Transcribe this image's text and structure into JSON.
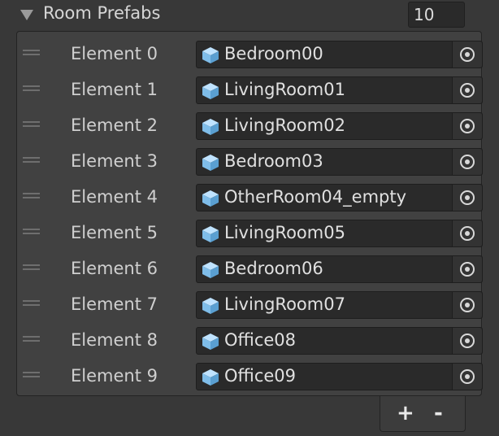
{
  "header": {
    "title": "Room Prefabs",
    "size_value": "10"
  },
  "list": {
    "items": [
      {
        "label": "Element 0",
        "value": "Bedroom00"
      },
      {
        "label": "Element 1",
        "value": "LivingRoom01"
      },
      {
        "label": "Element 2",
        "value": "LivingRoom02"
      },
      {
        "label": "Element 3",
        "value": "Bedroom03"
      },
      {
        "label": "Element 4",
        "value": "OtherRoom04_empty"
      },
      {
        "label": "Element 5",
        "value": "LivingRoom05"
      },
      {
        "label": "Element 6",
        "value": "Bedroom06"
      },
      {
        "label": "Element 7",
        "value": "LivingRoom07"
      },
      {
        "label": "Element 8",
        "value": "Office08"
      },
      {
        "label": "Element 9",
        "value": "Office09"
      }
    ]
  },
  "footer": {
    "add_label": "+",
    "remove_label": "-"
  },
  "icons": {
    "item_icon": "prefab-cube-icon",
    "picker_icon": "object-picker-target-icon"
  },
  "colors": {
    "background": "#383838",
    "list_background": "#414141",
    "field_background": "#2a2a2a",
    "prefab_icon": "#8fc7f0",
    "text": "#d2d2d2"
  }
}
